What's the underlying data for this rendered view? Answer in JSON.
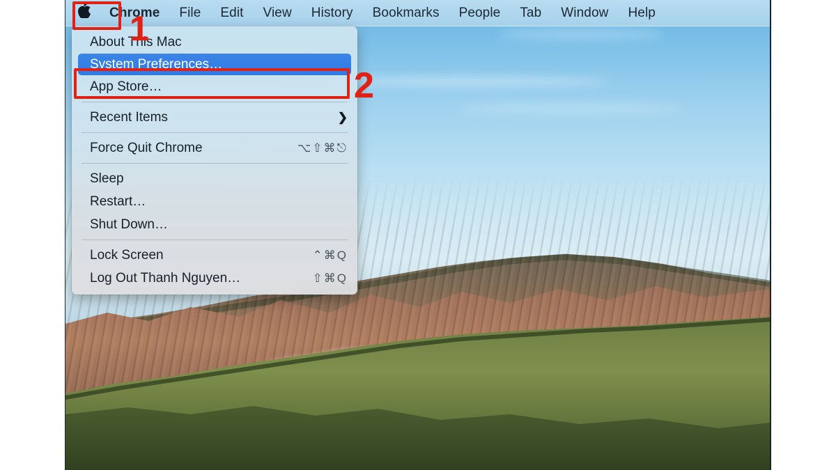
{
  "os": "macOS",
  "menubar": {
    "apple_icon": "apple-logo-icon",
    "apple_glyph": "",
    "items": [
      {
        "label": "Chrome",
        "bold": true
      },
      {
        "label": "File",
        "bold": false
      },
      {
        "label": "Edit",
        "bold": false
      },
      {
        "label": "View",
        "bold": false
      },
      {
        "label": "History",
        "bold": false
      },
      {
        "label": "Bookmarks",
        "bold": false
      },
      {
        "label": "People",
        "bold": false
      },
      {
        "label": "Tab",
        "bold": false
      },
      {
        "label": "Window",
        "bold": false
      },
      {
        "label": "Help",
        "bold": false
      }
    ]
  },
  "apple_menu": {
    "groups": [
      {
        "items": [
          {
            "label": "About This Mac",
            "shortcut": "",
            "selected": false,
            "submenu": false
          },
          {
            "label": "System Preferences…",
            "shortcut": "",
            "selected": true,
            "submenu": false
          },
          {
            "label": "App Store…",
            "shortcut": "",
            "selected": false,
            "submenu": false
          }
        ]
      },
      {
        "items": [
          {
            "label": "Recent Items",
            "shortcut": "",
            "selected": false,
            "submenu": true,
            "submenu_glyph": "❯"
          }
        ]
      },
      {
        "items": [
          {
            "label": "Force Quit Chrome",
            "shortcut": "⌥⇧⌘⎋",
            "selected": false,
            "submenu": false
          }
        ]
      },
      {
        "items": [
          {
            "label": "Sleep",
            "shortcut": "",
            "selected": false,
            "submenu": false
          },
          {
            "label": "Restart…",
            "shortcut": "",
            "selected": false,
            "submenu": false
          },
          {
            "label": "Shut Down…",
            "shortcut": "",
            "selected": false,
            "submenu": false
          }
        ]
      },
      {
        "items": [
          {
            "label": "Lock Screen",
            "shortcut": "⌃⌘Q",
            "selected": false,
            "submenu": false
          },
          {
            "label": "Log Out Thanh Nguyen…",
            "shortcut": "⇧⌘Q",
            "selected": false,
            "submenu": false
          }
        ]
      }
    ]
  },
  "annotations": {
    "step_1": "1",
    "step_2": "2",
    "color": "#e02216",
    "box_1_target": "apple-menu-bar-icon",
    "box_2_target": "system-preferences-menu-item"
  },
  "wallpaper": {
    "name": "mountain-range-wallpaper",
    "sky_color": "#9ed1ee",
    "ridge_color": "#8d6a57",
    "foliage_color": "#5d7a3c"
  }
}
